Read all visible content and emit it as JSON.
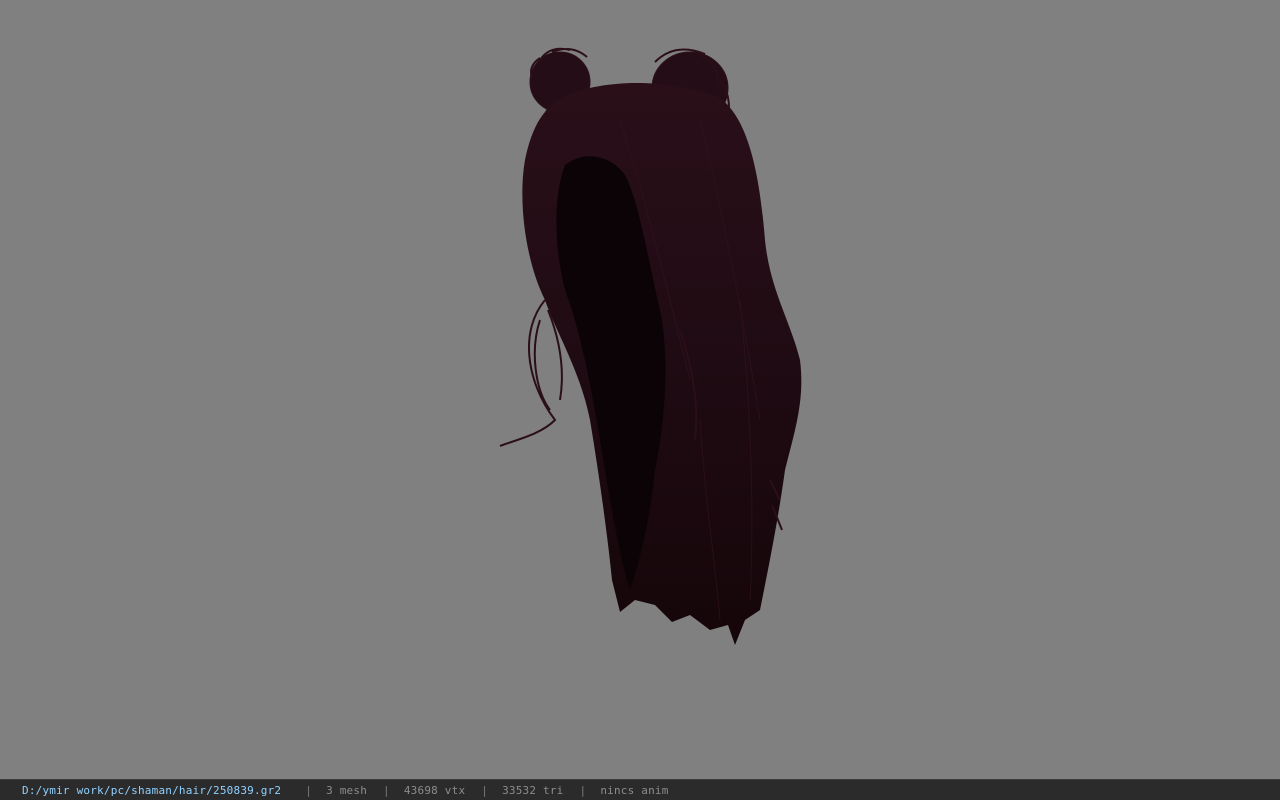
{
  "viewport": {
    "background_color": "#808080",
    "model_color": "#1f0c13",
    "model_shadow_color": "#0a0306",
    "model_icon": "hair-model"
  },
  "statusbar": {
    "file_path": "D:/ymir work/pc/shaman/hair/250839.gr2",
    "separator": "|",
    "mesh_count": "3 mesh",
    "vertex_count": "43698 vtx",
    "triangle_count": "33532 tri",
    "anim_status": "nincs anim"
  }
}
